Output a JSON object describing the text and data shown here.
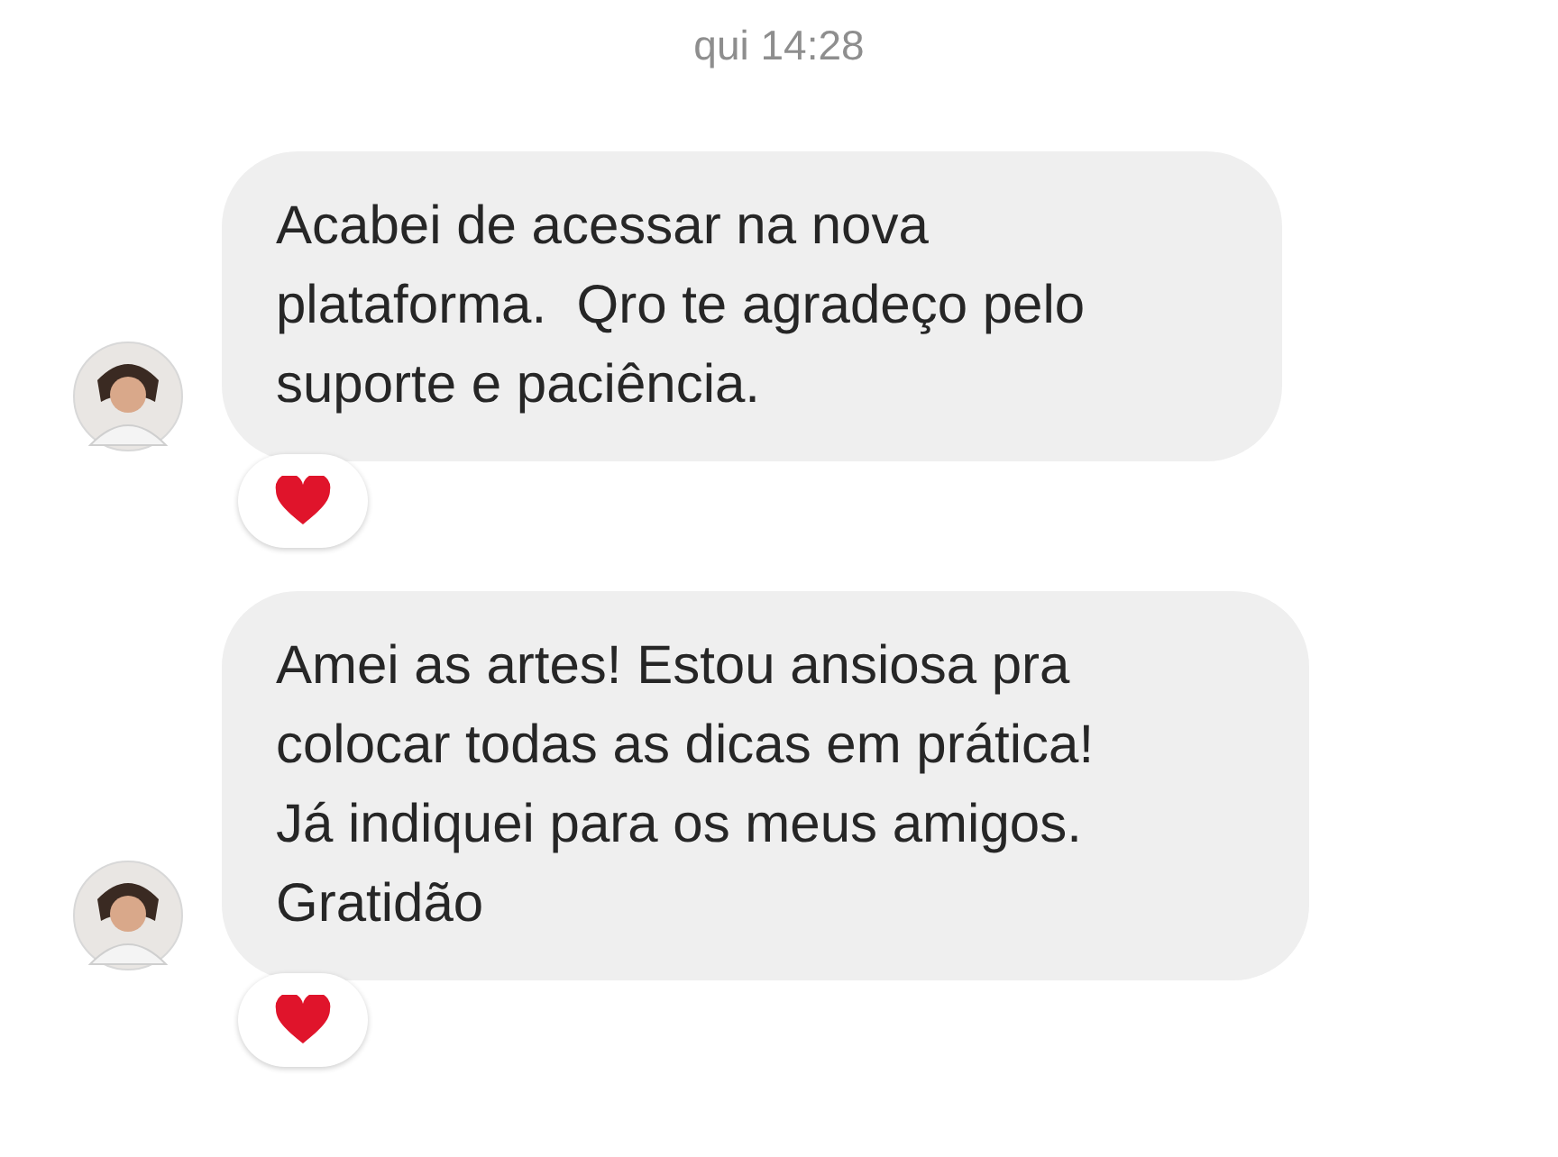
{
  "timestamp": "qui 14:28",
  "messages": [
    {
      "text": "Acabei de acessar na nova\nplataforma.  Qro te agradeço pelo\nsuporte e paciência.",
      "reacted": true
    },
    {
      "text": "Amei as artes! Estou ansiosa pra\ncolocar todas as dicas em prática!\nJá indiquei para os meus amigos.\nGratidão",
      "reacted": true
    }
  ]
}
